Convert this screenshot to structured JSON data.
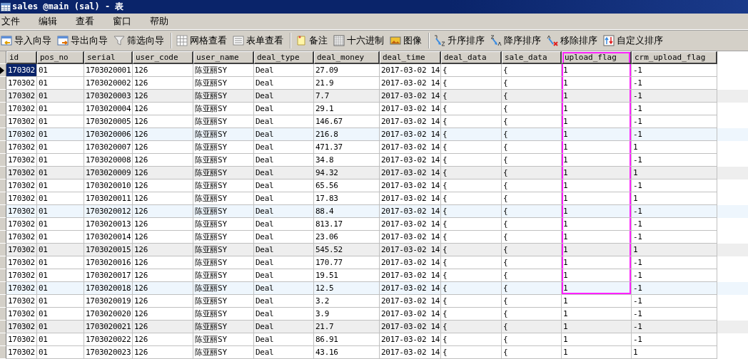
{
  "window": {
    "title": "sales @main (sal) - 表"
  },
  "menu": [
    "文件",
    "编辑",
    "查看",
    "窗口",
    "帮助"
  ],
  "toolbar": [
    [
      "导入向导",
      "导出向导",
      "筛选向导"
    ],
    [
      "网格查看",
      "表单查看"
    ],
    [
      "备注",
      "十六进制",
      "图像"
    ],
    [
      "升序排序",
      "降序排序",
      "移除排序",
      "自定义排序"
    ]
  ],
  "table": {
    "columns": [
      {
        "label": "id",
        "highlighted": false
      },
      {
        "label": "pos_no",
        "highlighted": false
      },
      {
        "label": "serial",
        "highlighted": false
      },
      {
        "label": "user_code",
        "highlighted": false
      },
      {
        "label": "user_name",
        "highlighted": false
      },
      {
        "label": "deal_type",
        "highlighted": false
      },
      {
        "label": "deal_money",
        "highlighted": false
      },
      {
        "label": "deal_time",
        "highlighted": false
      },
      {
        "label": "deal_data",
        "highlighted": false
      },
      {
        "label": "sale_data",
        "highlighted": false
      },
      {
        "label": "upload_flag",
        "highlighted": true
      },
      {
        "label": "crm_upload_flag",
        "highlighted": false
      }
    ],
    "rows": [
      {
        "selected": true,
        "marked": true,
        "color": "#ffffff",
        "cells": [
          "170302",
          "01",
          "1703020001",
          "126",
          "陈亚丽SY",
          "Deal",
          "27.09",
          "2017-03-02 14",
          "{",
          "{",
          "1",
          "-1"
        ]
      },
      {
        "selected": false,
        "marked": true,
        "color": "#ffffff",
        "cells": [
          "170302",
          "01",
          "1703020002",
          "126",
          "陈亚丽SY",
          "Deal",
          "21.9",
          "2017-03-02 14",
          "{",
          "{",
          "1",
          "-1"
        ]
      },
      {
        "selected": false,
        "marked": true,
        "color": "#eeeeee",
        "cells": [
          "170302",
          "01",
          "1703020003",
          "126",
          "陈亚丽SY",
          "Deal",
          "7.7",
          "2017-03-02 14",
          "{",
          "{",
          "1",
          "-1"
        ]
      },
      {
        "selected": false,
        "marked": true,
        "color": "#ffffff",
        "cells": [
          "170302",
          "01",
          "1703020004",
          "126",
          "陈亚丽SY",
          "Deal",
          "29.1",
          "2017-03-02 14",
          "{",
          "{",
          "1",
          "-1"
        ]
      },
      {
        "selected": false,
        "marked": true,
        "color": "#ffffff",
        "cells": [
          "170302",
          "01",
          "1703020005",
          "126",
          "陈亚丽SY",
          "Deal",
          "146.67",
          "2017-03-02 14",
          "{",
          "{",
          "1",
          "-1"
        ]
      },
      {
        "selected": false,
        "marked": true,
        "color": "#eef6fd",
        "cells": [
          "170302",
          "01",
          "1703020006",
          "126",
          "陈亚丽SY",
          "Deal",
          "216.8",
          "2017-03-02 14",
          "{",
          "{",
          "1",
          "-1"
        ]
      },
      {
        "selected": false,
        "marked": true,
        "color": "#ffffff",
        "cells": [
          "170302",
          "01",
          "1703020007",
          "126",
          "陈亚丽SY",
          "Deal",
          "471.37",
          "2017-03-02 14",
          "{",
          "{",
          "1",
          "1"
        ]
      },
      {
        "selected": false,
        "marked": true,
        "color": "#ffffff",
        "cells": [
          "170302",
          "01",
          "1703020008",
          "126",
          "陈亚丽SY",
          "Deal",
          "34.8",
          "2017-03-02 14",
          "{",
          "{",
          "1",
          "-1"
        ]
      },
      {
        "selected": false,
        "marked": true,
        "color": "#eeeeee",
        "cells": [
          "170302",
          "01",
          "1703020009",
          "126",
          "陈亚丽SY",
          "Deal",
          "94.32",
          "2017-03-02 14",
          "{",
          "{",
          "1",
          "1"
        ]
      },
      {
        "selected": false,
        "marked": true,
        "color": "#ffffff",
        "cells": [
          "170302",
          "01",
          "1703020010",
          "126",
          "陈亚丽SY",
          "Deal",
          "65.56",
          "2017-03-02 14",
          "{",
          "{",
          "1",
          "-1"
        ]
      },
      {
        "selected": false,
        "marked": true,
        "color": "#ffffff",
        "cells": [
          "170302",
          "01",
          "1703020011",
          "126",
          "陈亚丽SY",
          "Deal",
          "17.83",
          "2017-03-02 14",
          "{",
          "{",
          "1",
          "1"
        ]
      },
      {
        "selected": false,
        "marked": true,
        "color": "#eef6fd",
        "cells": [
          "170302",
          "01",
          "1703020012",
          "126",
          "陈亚丽SY",
          "Deal",
          "88.4",
          "2017-03-02 14",
          "{",
          "{",
          "1",
          "-1"
        ]
      },
      {
        "selected": false,
        "marked": true,
        "color": "#ffffff",
        "cells": [
          "170302",
          "01",
          "1703020013",
          "126",
          "陈亚丽SY",
          "Deal",
          "813.17",
          "2017-03-02 14",
          "{",
          "{",
          "1",
          "-1"
        ]
      },
      {
        "selected": false,
        "marked": true,
        "color": "#ffffff",
        "cells": [
          "170302",
          "01",
          "1703020014",
          "126",
          "陈亚丽SY",
          "Deal",
          "23.06",
          "2017-03-02 14",
          "{",
          "{",
          "1",
          "-1"
        ]
      },
      {
        "selected": false,
        "marked": true,
        "color": "#eeeeee",
        "cells": [
          "170302",
          "01",
          "1703020015",
          "126",
          "陈亚丽SY",
          "Deal",
          "545.52",
          "2017-03-02 14",
          "{",
          "{",
          "1",
          "1"
        ]
      },
      {
        "selected": false,
        "marked": true,
        "color": "#ffffff",
        "cells": [
          "170302",
          "01",
          "1703020016",
          "126",
          "陈亚丽SY",
          "Deal",
          "170.77",
          "2017-03-02 14",
          "{",
          "{",
          "1",
          "-1"
        ]
      },
      {
        "selected": false,
        "marked": true,
        "color": "#ffffff",
        "cells": [
          "170302",
          "01",
          "1703020017",
          "126",
          "陈亚丽SY",
          "Deal",
          "19.51",
          "2017-03-02 14",
          "{",
          "{",
          "1",
          "-1"
        ]
      },
      {
        "selected": false,
        "marked": true,
        "color": "#eef6fd",
        "cells": [
          "170302",
          "01",
          "1703020018",
          "126",
          "陈亚丽SY",
          "Deal",
          "12.5",
          "2017-03-02 14",
          "{",
          "{",
          "1",
          "-1"
        ]
      },
      {
        "selected": false,
        "marked": false,
        "color": "#ffffff",
        "cells": [
          "170302",
          "01",
          "1703020019",
          "126",
          "陈亚丽SY",
          "Deal",
          "3.2",
          "2017-03-02 14",
          "{",
          "{",
          "1",
          "-1"
        ]
      },
      {
        "selected": false,
        "marked": false,
        "color": "#ffffff",
        "cells": [
          "170302",
          "01",
          "1703020020",
          "126",
          "陈亚丽SY",
          "Deal",
          "3.9",
          "2017-03-02 14",
          "{",
          "{",
          "1",
          "-1"
        ]
      },
      {
        "selected": false,
        "marked": false,
        "color": "#eeeeee",
        "cells": [
          "170302",
          "01",
          "1703020021",
          "126",
          "陈亚丽SY",
          "Deal",
          "21.7",
          "2017-03-02 14",
          "{",
          "{",
          "1",
          "-1"
        ]
      },
      {
        "selected": false,
        "marked": false,
        "color": "#ffffff",
        "cells": [
          "170302",
          "01",
          "1703020022",
          "126",
          "陈亚丽SY",
          "Deal",
          "86.91",
          "2017-03-02 14",
          "{",
          "{",
          "1",
          "-1"
        ]
      },
      {
        "selected": false,
        "marked": false,
        "color": "#ffffff",
        "cells": [
          "170302",
          "01",
          "1703020023",
          "126",
          "陈亚丽SY",
          "Deal",
          "43.16",
          "2017-03-02 14",
          "{",
          "{",
          "1",
          "1"
        ]
      }
    ]
  }
}
